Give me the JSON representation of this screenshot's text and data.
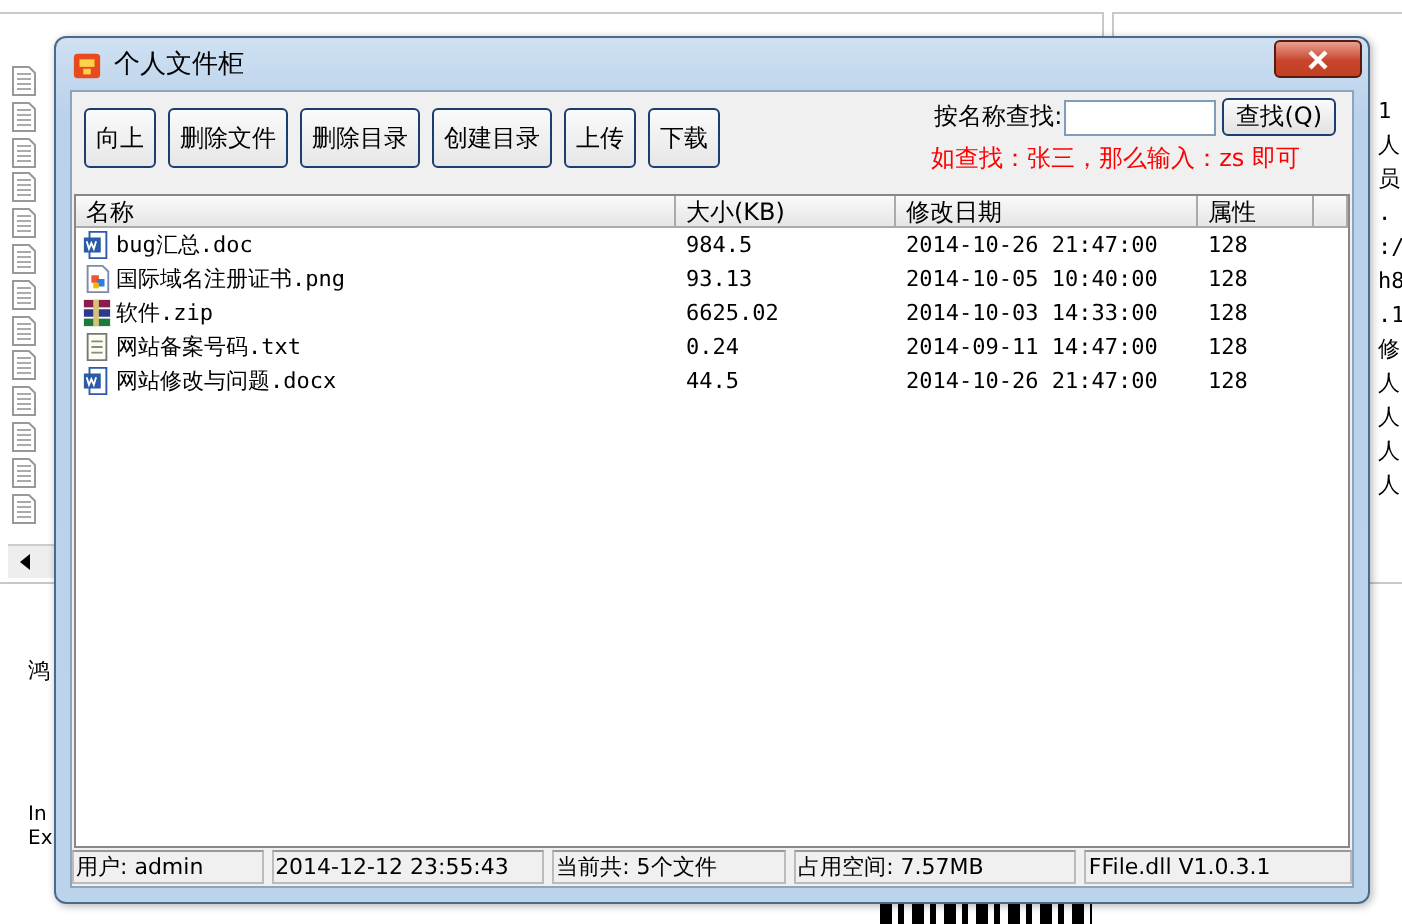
{
  "background": {
    "left_fragments": [
      "鸿",
      "In",
      "Ex"
    ],
    "message_fragments": [
      "1",
      "人",
      "员",
      ".",
      ":/",
      "h8",
      ".1",
      "修",
      "人",
      "人",
      "人",
      "人"
    ]
  },
  "dialog": {
    "title": "个人文件柜",
    "toolbar": [
      "向上",
      "删除文件",
      "删除目录",
      "创建目录",
      "上传",
      "下载"
    ],
    "search": {
      "label": "按名称查找:",
      "button": "查找(Q)",
      "hint": "如查找：张三，那么输入：zs 即可"
    },
    "columns": [
      "名称",
      "大小(KB)",
      "修改日期",
      "属性"
    ],
    "rows": [
      {
        "kind": "word",
        "name": "bug汇总.doc",
        "size": "984.5",
        "modified": "2014-10-26 21:47:00",
        "attr": "128"
      },
      {
        "kind": "image",
        "name": "国际域名注册证书.png",
        "size": "93.13",
        "modified": "2014-10-05 10:40:00",
        "attr": "128"
      },
      {
        "kind": "archive",
        "name": "软件.zip",
        "size": "6625.02",
        "modified": "2014-10-03 14:33:00",
        "attr": "128"
      },
      {
        "kind": "text",
        "name": "网站备案号码.txt",
        "size": "0.24",
        "modified": "2014-09-11 14:47:00",
        "attr": "128"
      },
      {
        "kind": "word",
        "name": "网站修改与问题.docx",
        "size": "44.5",
        "modified": "2014-10-26 21:47:00",
        "attr": "128"
      }
    ],
    "status_bar": [
      "用户: admin",
      "2014-12-12 23:55:43",
      "当前共: 5个文件",
      "占用空间:  7.57MB",
      "FFile.dll V1.0.3.1"
    ]
  }
}
